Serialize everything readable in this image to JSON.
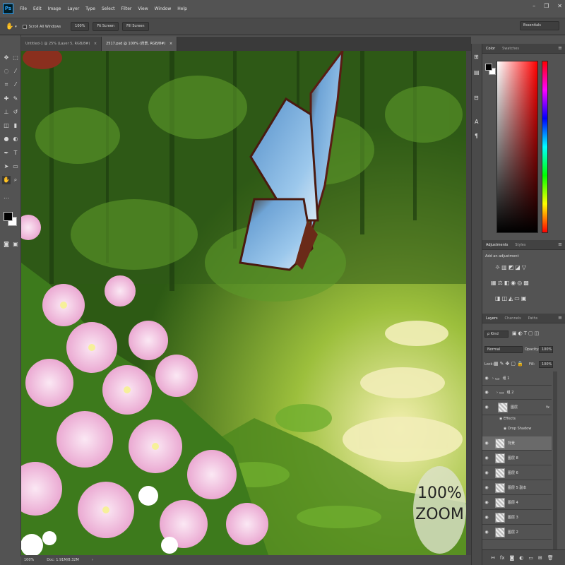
{
  "app": {
    "logo": "Ps",
    "menu": [
      "File",
      "Edit",
      "Image",
      "Layer",
      "Type",
      "Select",
      "Filter",
      "View",
      "Window",
      "Help"
    ],
    "window_controls": [
      "–",
      "❐",
      "✕"
    ]
  },
  "options_bar": {
    "scroll_all_windows": "Scroll All Windows",
    "zoom_value": "100%",
    "fit_screen": "Fit Screen",
    "fill_screen": "Fill Screen",
    "workspace": "Essentials"
  },
  "document_tabs": [
    {
      "label": "Untitled-1 @ 25% (Layer 5, RGB/8#)",
      "close": "×"
    },
    {
      "label": "2517.psd @ 100% (背景, RGB/8#)",
      "close": "×"
    }
  ],
  "canvas": {
    "zoom_badge_line1": "100%",
    "zoom_badge_line2": "ZOOM"
  },
  "status_bar": {
    "zoom": "100%",
    "doc": "Doc: 1.91M/8.32M"
  },
  "color_panel": {
    "tabs": [
      "Color",
      "Swatches"
    ],
    "foreground": "#000000",
    "background": "#ffffff",
    "accent_red": "#ff0000"
  },
  "adjustments_panel": {
    "tabs": [
      "Adjustments",
      "Styles"
    ],
    "hint": "Add an adjustment"
  },
  "layers_panel": {
    "tabs": [
      "Layers",
      "Channels",
      "Paths"
    ],
    "kind_filter": "ρ Kind",
    "blend_mode": "Normal",
    "opacity_label": "Opacity:",
    "opacity_value": "100%",
    "lock_label": "Lock:",
    "fill_label": "Fill:",
    "fill_value": "100%",
    "rows": [
      {
        "name": "组 1",
        "type": "folder",
        "fx": ""
      },
      {
        "name": "组 2",
        "type": "folder",
        "fx": ""
      },
      {
        "name": "图层",
        "type": "layer",
        "fx": "fx"
      },
      {
        "name": "Effects",
        "type": "effect",
        "fx": ""
      },
      {
        "name": "Drop Shadow",
        "type": "effect",
        "fx": ""
      },
      {
        "name": "背景",
        "type": "layer",
        "fx": "",
        "selected": true
      },
      {
        "name": "图层 8",
        "type": "layer",
        "fx": ""
      },
      {
        "name": "图层 6",
        "type": "layer",
        "fx": ""
      },
      {
        "name": "图层 5 副本",
        "type": "layer",
        "fx": ""
      },
      {
        "name": "图层 4",
        "type": "layer",
        "fx": ""
      },
      {
        "name": "图层 3",
        "type": "layer",
        "fx": ""
      },
      {
        "name": "图层 2",
        "type": "layer",
        "fx": ""
      }
    ]
  }
}
